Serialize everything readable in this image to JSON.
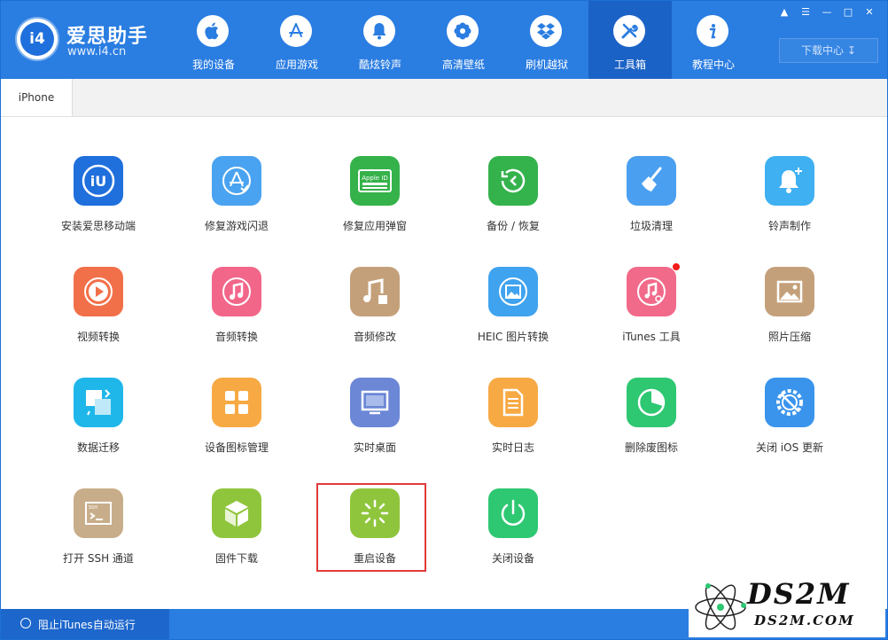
{
  "brand": {
    "name": "爱思助手",
    "url": "www.i4.cn",
    "logo_text": "i4"
  },
  "nav": [
    {
      "label": "我的设备",
      "icon": "apple-icon"
    },
    {
      "label": "应用游戏",
      "icon": "appstore-icon"
    },
    {
      "label": "酷炫铃声",
      "icon": "bell-icon"
    },
    {
      "label": "高清壁纸",
      "icon": "flower-icon"
    },
    {
      "label": "刷机越狱",
      "icon": "dropbox-icon"
    },
    {
      "label": "工具箱",
      "icon": "tools-icon",
      "active": true
    },
    {
      "label": "教程中心",
      "icon": "info-icon"
    }
  ],
  "download_button": "下载中心",
  "tabs": [
    {
      "label": "iPhone"
    }
  ],
  "tools": [
    {
      "label": "安装爱思移动端",
      "color": "#1f6fdc",
      "icon": "i4-logo-icon"
    },
    {
      "label": "修复游戏闪退",
      "color": "#4aa3f0",
      "icon": "appstore-fix-icon"
    },
    {
      "label": "修复应用弹窗",
      "color": "#35b24a",
      "icon": "apple-id-icon",
      "icon_text": "Apple ID"
    },
    {
      "label": "备份 / 恢复",
      "color": "#34b24c",
      "icon": "backup-restore-icon"
    },
    {
      "label": "垃圾清理",
      "color": "#4a9ff0",
      "icon": "broom-icon"
    },
    {
      "label": "铃声制作",
      "color": "#3fb0f2",
      "icon": "bell-plus-icon"
    },
    {
      "label": "视频转换",
      "color": "#f27049",
      "icon": "video-play-icon"
    },
    {
      "label": "音频转换",
      "color": "#f2668a",
      "icon": "music-note-icon"
    },
    {
      "label": "音频修改",
      "color": "#c4a07a",
      "icon": "music-edit-icon"
    },
    {
      "label": "HEIC 图片转换",
      "color": "#3fa3ef",
      "icon": "heic-image-icon"
    },
    {
      "label": "iTunes 工具",
      "color": "#f26a8a",
      "icon": "itunes-icon",
      "badge": true
    },
    {
      "label": "照片压缩",
      "color": "#c4a07a",
      "icon": "photo-icon"
    },
    {
      "label": "数据迁移",
      "color": "#1fb7ea",
      "icon": "data-migrate-icon"
    },
    {
      "label": "设备图标管理",
      "color": "#f7a944",
      "icon": "icon-grid-icon"
    },
    {
      "label": "实时桌面",
      "color": "#6b87d6",
      "icon": "monitor-icon"
    },
    {
      "label": "实时日志",
      "color": "#f7a944",
      "icon": "document-icon"
    },
    {
      "label": "删除废图标",
      "color": "#2ec772",
      "icon": "pie-icon"
    },
    {
      "label": "关闭 iOS 更新",
      "color": "#3a94ec",
      "icon": "gear-off-icon"
    },
    {
      "label": "打开 SSH 通道",
      "color": "#c8ad8a",
      "icon": "terminal-icon",
      "icon_text": "SSH"
    },
    {
      "label": "固件下载",
      "color": "#8fc53c",
      "icon": "cube-icon"
    },
    {
      "label": "重启设备",
      "color": "#8fc53c",
      "icon": "restart-spinner-icon",
      "highlighted": true
    },
    {
      "label": "关闭设备",
      "color": "#2ec772",
      "icon": "power-icon"
    }
  ],
  "status": {
    "text": "阻止iTunes自动运行"
  },
  "watermark": {
    "big": "DS2M",
    "small": "DS2M.COM"
  }
}
